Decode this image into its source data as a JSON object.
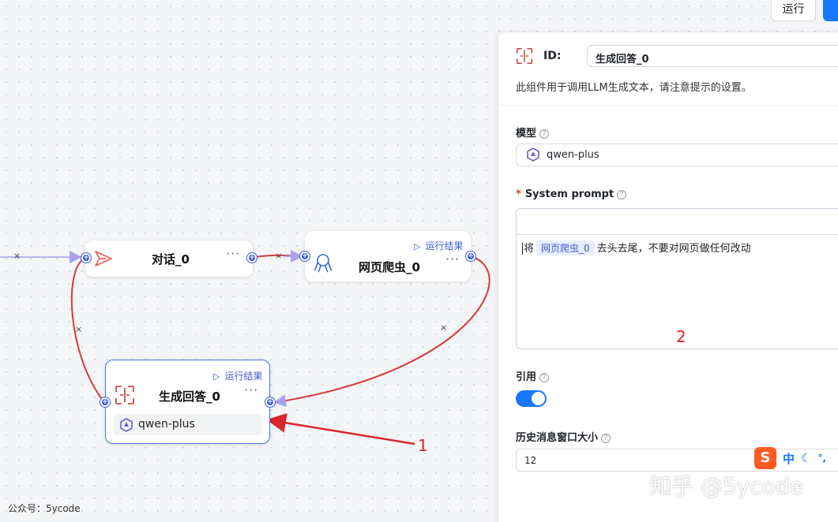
{
  "toolbar": {
    "run_label": "运行"
  },
  "nodes": {
    "dialog": {
      "title": "对话_0",
      "more": "···"
    },
    "crawler": {
      "title": "网页爬虫_0",
      "more": "···",
      "run_result": "运行结果"
    },
    "generate": {
      "title": "生成回答_0",
      "more": "···",
      "run_result": "运行结果",
      "model": "qwen-plus"
    }
  },
  "edges": {
    "delete_glyph": "×"
  },
  "panel": {
    "id_label": "ID:",
    "id_value": "生成回答_0",
    "description": "此组件用于调用LLM生成文本，请注意提示的设置。",
    "model_label": "模型",
    "model_value": "qwen-plus",
    "required_mark": "*",
    "system_prompt_label": "System prompt",
    "prompt_prefix": "将",
    "prompt_tag": "网页爬虫_0",
    "prompt_suffix": "去头去尾，不要对网页做任何改动",
    "quote_label": "引用",
    "quote_enabled": true,
    "history_label": "历史消息窗口大小",
    "history_value": "12",
    "help_glyph": "?"
  },
  "annotations": {
    "one": "1",
    "two": "2"
  },
  "ime": {
    "lang": "中",
    "punct": "°,"
  },
  "watermark": "知乎 @5ycode",
  "footer_note": "公众号：5ycode",
  "colors": {
    "accent": "#1677ff",
    "edge_red": "#d63a3a",
    "edge_purple": "#a9a2e8",
    "handle": "#3b5bdb",
    "annotation": "#d9262c"
  }
}
